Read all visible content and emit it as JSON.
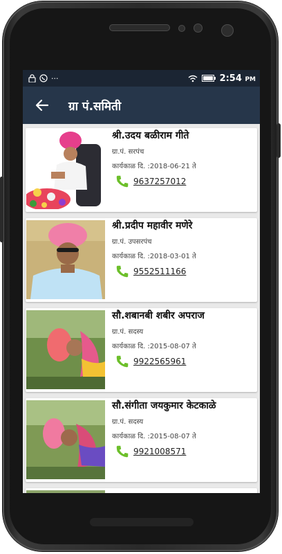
{
  "status_bar": {
    "time": "2:54",
    "ampm": "PM",
    "overflow": "···"
  },
  "app_bar": {
    "title": "ग्रा पं.समिती",
    "back_icon": "arrow-left-icon"
  },
  "members": [
    {
      "name": "श्री.उदय बळीराम गीते",
      "role": "ग्रा.पं. सरपंच",
      "tenure": "कार्यकाळ दि. :2018-06-21 ते",
      "phone": "9637257012"
    },
    {
      "name": "श्री.प्रदीप महावीर मणेरे",
      "role": "ग्रा.पं. उपसरपंच",
      "tenure": "कार्यकाळ दि. :2018-03-01 ते",
      "phone": "9552511166"
    },
    {
      "name": "सौ.शबानबी  शबीर अपराज",
      "role": "ग्रा.पं. सदस्य",
      "tenure": "कार्यकाळ दि. :2015-08-07 ते",
      "phone": "9922565961"
    },
    {
      "name": "सौ.संगीता जयकुमार  केटकाळे",
      "role": "ग्रा.पं. सदस्य",
      "tenure": "कार्यकाळ दि. :2015-08-07 ते",
      "phone": "9921008571"
    }
  ],
  "colors": {
    "status_bar": "#1b2533",
    "app_bar": "#26364a",
    "list_bg": "#e9e9e9",
    "phone_icon": "#6cbf2a"
  }
}
